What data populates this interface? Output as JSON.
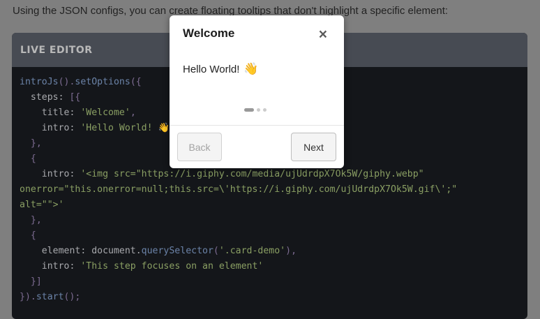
{
  "page": {
    "intro_text": "Using the JSON configs, you can create floating tooltips that don't highlight a specific element:"
  },
  "editor": {
    "header": "LIVE EDITOR",
    "lines": [
      [
        [
          "fn",
          "introJs"
        ],
        [
          "pun",
          "()."
        ],
        [
          "fn",
          "setOptions"
        ],
        [
          "pun",
          "({"
        ]
      ],
      [
        [
          "plain",
          "  steps: "
        ],
        [
          "pun",
          "[{"
        ]
      ],
      [
        [
          "plain",
          "    title: "
        ],
        [
          "str",
          "'Welcome'"
        ],
        [
          "pun",
          ","
        ]
      ],
      [
        [
          "plain",
          "    intro: "
        ],
        [
          "str",
          "'Hello World! 👋'"
        ]
      ],
      [
        [
          "pun",
          "  },"
        ]
      ],
      [
        [
          "pun",
          "  {"
        ]
      ],
      [
        [
          "plain",
          "    intro: "
        ],
        [
          "str",
          "'<img src=\"https://i.giphy.com/media/ujUdrdpX7Ok5W/giphy.webp\""
        ]
      ],
      [
        [
          "str",
          "onerror=\"this.onerror=null;this.src=\\'https://i.giphy.com/ujUdrdpX7Ok5W.gif\\';\""
        ]
      ],
      [
        [
          "str",
          "alt=\"\">'"
        ]
      ],
      [
        [
          "pun",
          "  },"
        ]
      ],
      [
        [
          "pun",
          "  {"
        ]
      ],
      [
        [
          "plain",
          "    element: document."
        ],
        [
          "fn",
          "querySelector"
        ],
        [
          "pun",
          "("
        ],
        [
          "str",
          "'.card-demo'"
        ],
        [
          "pun",
          "),"
        ]
      ],
      [
        [
          "plain",
          "    intro: "
        ],
        [
          "str",
          "'This step focuses on an element'"
        ]
      ],
      [
        [
          "pun",
          "  }]"
        ]
      ],
      [
        [
          "pun",
          "})."
        ],
        [
          "fn",
          "start"
        ],
        [
          "pun",
          "();"
        ]
      ]
    ]
  },
  "tooltip": {
    "title": "Welcome",
    "close_glyph": "×",
    "body": "Hello World!",
    "body_emoji": "👋",
    "step_current": 1,
    "step_total": 3,
    "back_label": "Back",
    "next_label": "Next"
  }
}
